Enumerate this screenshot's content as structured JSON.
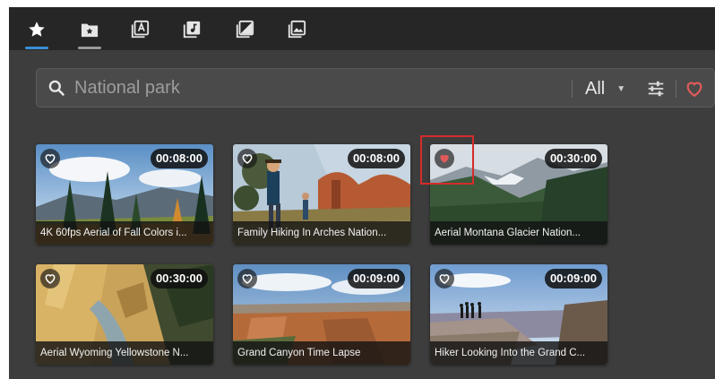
{
  "tabs": [
    {
      "icon": "star-icon",
      "active": true
    },
    {
      "icon": "folder-star-icon",
      "active": false
    },
    {
      "icon": "text-library-icon",
      "active": false
    },
    {
      "icon": "music-library-icon",
      "active": false
    },
    {
      "icon": "image-edit-icon",
      "active": false
    },
    {
      "icon": "photo-library-icon",
      "active": false
    }
  ],
  "search": {
    "placeholder": "National park",
    "value": "",
    "filter_label": "All"
  },
  "colors": {
    "accent_blue": "#3a8fd6",
    "favorite_red": "#e05a5a",
    "highlight_red": "#d62b2b"
  },
  "videos": [
    {
      "title": "4K 60fps Aerial of Fall Colors i...",
      "duration": "00:08:00",
      "favorited": false
    },
    {
      "title": "Family Hiking In Arches Nation...",
      "duration": "00:08:00",
      "favorited": false
    },
    {
      "title": "Aerial Montana Glacier Nation...",
      "duration": "00:30:00",
      "favorited": true
    },
    {
      "title": "Aerial Wyoming Yellowstone N...",
      "duration": "00:30:00",
      "favorited": false
    },
    {
      "title": "Grand Canyon Time Lapse",
      "duration": "00:09:00",
      "favorited": false
    },
    {
      "title": "Hiker Looking Into the Grand C...",
      "duration": "00:09:00",
      "favorited": false
    }
  ]
}
